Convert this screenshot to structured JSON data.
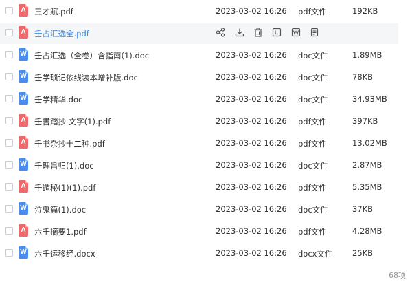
{
  "files": [
    {
      "name": "三才賦.pdf",
      "date": "2023-03-02 16:26",
      "type": "pdf文件",
      "size": "192KB",
      "icon": "pdf-file-icon",
      "icon_glyph": "A"
    },
    {
      "name": "壬占汇选全.pdf",
      "date": "",
      "type": "",
      "size": "",
      "icon": "pdf-file-icon",
      "icon_glyph": "A"
    },
    {
      "name": "壬占汇选（全卷）含指南(1).doc",
      "date": "2023-03-02 16:26",
      "type": "doc文件",
      "size": "1.89MB",
      "icon": "word-file-icon",
      "icon_glyph": "W"
    },
    {
      "name": "壬学琐记依线装本增补版.doc",
      "date": "2023-03-02 16:26",
      "type": "doc文件",
      "size": "78KB",
      "icon": "word-file-icon",
      "icon_glyph": "W"
    },
    {
      "name": "壬学精华.doc",
      "date": "2023-03-02 16:26",
      "type": "doc文件",
      "size": "34.93MB",
      "icon": "word-file-icon",
      "icon_glyph": "W"
    },
    {
      "name": "壬書踏抄 文字(1).pdf",
      "date": "2023-03-02 16:26",
      "type": "pdf文件",
      "size": "397KB",
      "icon": "pdf-file-icon",
      "icon_glyph": "A"
    },
    {
      "name": "壬书杂抄十二种.pdf",
      "date": "2023-03-02 16:26",
      "type": "pdf文件",
      "size": "13.02MB",
      "icon": "pdf-file-icon",
      "icon_glyph": "A"
    },
    {
      "name": "壬理旨归(1).doc",
      "date": "2023-03-02 16:26",
      "type": "doc文件",
      "size": "2.87MB",
      "icon": "word-file-icon",
      "icon_glyph": "W"
    },
    {
      "name": "壬遁秘(1)(1).pdf",
      "date": "2023-03-02 16:26",
      "type": "pdf文件",
      "size": "5.35MB",
      "icon": "pdf-file-icon",
      "icon_glyph": "A"
    },
    {
      "name": "泣鬼篇(1).doc",
      "date": "2023-03-02 16:26",
      "type": "doc文件",
      "size": "37KB",
      "icon": "word-file-icon",
      "icon_glyph": "W"
    },
    {
      "name": "六壬摘要1.pdf",
      "date": "2023-03-02 16:26",
      "type": "pdf文件",
      "size": "4.28MB",
      "icon": "pdf-file-icon",
      "icon_glyph": "A"
    },
    {
      "name": "六壬运移经.docx",
      "date": "2023-03-02 16:26",
      "type": "docx文件",
      "size": "25KB",
      "icon": "word-file-icon",
      "icon_glyph": "W"
    }
  ],
  "hovered_row_actions": [
    {
      "name": "share-icon"
    },
    {
      "name": "download-icon"
    },
    {
      "name": "delete-icon"
    },
    {
      "name": "rename-icon"
    },
    {
      "name": "word-open-icon"
    },
    {
      "name": "more-details-icon"
    }
  ],
  "footer": {
    "item_count": "68项"
  },
  "colors": {
    "pdf": "#f0696a",
    "doc": "#4a8ef0",
    "link": "#3a8ee6",
    "hover_bg": "#f5f6f8"
  }
}
